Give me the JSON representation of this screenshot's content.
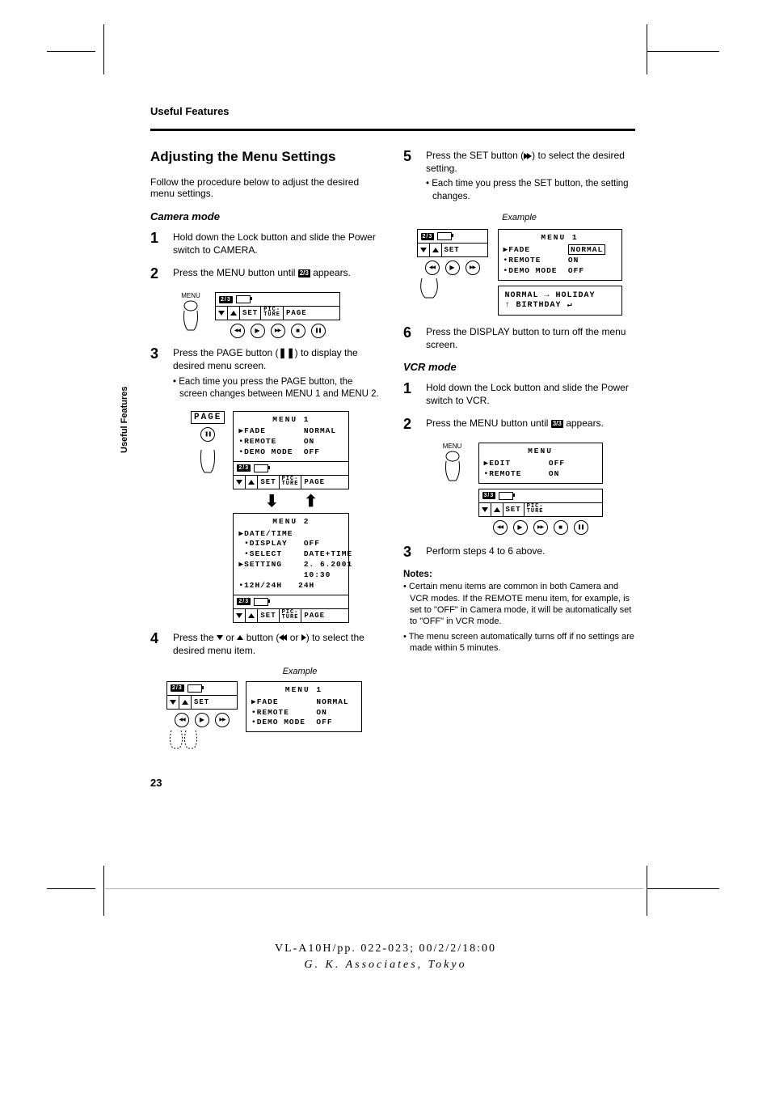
{
  "running_head": "Useful Features",
  "spine_label": "Useful Features",
  "title": "Adjusting the Menu Settings",
  "intro": "Follow the procedure below to adjust the desired menu settings.",
  "camera_mode": {
    "heading": "Camera mode",
    "steps": {
      "s1": "Hold down the Lock button and slide the Power switch to CAMERA.",
      "s2_a": "Press the MENU button until ",
      "s2_chip": "2/3",
      "s2_b": " appears.",
      "s3_a": "Press the PAGE button (",
      "s3_b": ") to display the desired menu screen.",
      "s3_note": "• Each time you press the PAGE button, the screen changes between MENU 1 and MENU 2.",
      "s4_a": "Press the ",
      "s4_b": " or ",
      "s4_c": " button (",
      "s4_d": " or ",
      "s4_e": ") to select the desired menu item."
    }
  },
  "labels": {
    "menu_button": "MENU",
    "page_button": "PAGE",
    "set": "SET",
    "picture": "PIC-\nTURE",
    "page": "PAGE",
    "example": "Example"
  },
  "osd": {
    "menu1_title": "MENU 1",
    "menu1_lines": "▶FADE       NORMAL\n•REMOTE     ON\n•DEMO MODE  OFF",
    "menu2_title": "MENU 2",
    "menu2_lines": "▶DATE/TIME\n •DISPLAY   OFF\n •SELECT    DATE+TIME\n▶SETTING    2. 6.2001\n            10:30\n•12H/24H   24H",
    "vcr_menu_title": "MENU",
    "vcr_menu_lines": "▶EDIT       OFF\n•REMOTE     ON"
  },
  "right": {
    "s5_a": "Press the SET button (",
    "s5_b": ") to select the desired setting.",
    "s5_note": "• Each time you press the SET button, the setting changes.",
    "transition_line1": "NORMAL → HOLIDAY",
    "transition_line2": "   ↑ BIRTHDAY ↵",
    "s6": "Press the DISPLAY button to turn off the menu screen."
  },
  "vcr_mode": {
    "heading": "VCR mode",
    "s1": "Hold down the Lock button and slide the Power switch to VCR.",
    "s2_a": "Press the MENU button until ",
    "s2_chip": "3/3",
    "s2_b": " appears.",
    "s3": "Perform steps 4 to 6 above."
  },
  "notes": {
    "head": "Notes:",
    "n1": "• Certain menu items are common in both Camera and VCR modes. If the REMOTE menu item, for example, is set to \"OFF\" in Camera mode, it will be automatically set to \"OFF\" in VCR mode.",
    "n2": "• The menu screen automatically turns off if no settings are made within 5 minutes."
  },
  "page_number": "23",
  "footer_line1": "VL-A10H/pp. 022-023; 00/2/2/18:00",
  "footer_line2": "G. K. Associates, Tokyo",
  "menu1_highlight": "NORMAL"
}
